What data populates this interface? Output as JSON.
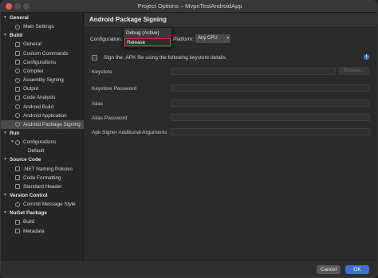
{
  "window": {
    "title": "Project Options – MvpnTestAndroidApp"
  },
  "sidebar": {
    "rows": [
      {
        "type": "group",
        "label": "General"
      },
      {
        "type": "item",
        "label": "Main Settings",
        "icon": "settings-icon"
      },
      {
        "type": "group",
        "label": "Build"
      },
      {
        "type": "item",
        "label": "General",
        "icon": "build-icon"
      },
      {
        "type": "item",
        "label": "Custom Commands",
        "icon": "terminal-icon"
      },
      {
        "type": "item",
        "label": "Configurations",
        "icon": "configurations-icon"
      },
      {
        "type": "item",
        "label": "Compiler",
        "icon": "gear-icon"
      },
      {
        "type": "item",
        "label": "Assembly Signing",
        "icon": "gear-icon"
      },
      {
        "type": "item",
        "label": "Output",
        "icon": "output-icon"
      },
      {
        "type": "item",
        "label": "Code Analysis",
        "icon": "code-analysis-icon"
      },
      {
        "type": "item",
        "label": "Android Build",
        "icon": "gear-icon"
      },
      {
        "type": "item",
        "label": "Android Application",
        "icon": "gear-icon"
      },
      {
        "type": "item",
        "label": "Android Package Signing",
        "icon": "gear-icon",
        "selected": true
      },
      {
        "type": "group",
        "label": "Run"
      },
      {
        "type": "item",
        "label": "Configurations",
        "icon": "gear-icon"
      },
      {
        "type": "subitem",
        "label": "Default"
      },
      {
        "type": "group",
        "label": "Source Code"
      },
      {
        "type": "item",
        "label": ".NET Naming Policies",
        "icon": "document-icon"
      },
      {
        "type": "item",
        "label": "Code Formatting",
        "icon": "document-icon"
      },
      {
        "type": "item",
        "label": "Standard Header",
        "icon": "document-icon"
      },
      {
        "type": "group",
        "label": "Version Control"
      },
      {
        "type": "item",
        "label": "Commit Message Style",
        "icon": "gear-icon"
      },
      {
        "type": "group",
        "label": "NuGet Package"
      },
      {
        "type": "item",
        "label": "Build",
        "icon": "document-icon"
      },
      {
        "type": "item",
        "label": "Metadata",
        "icon": "document-icon"
      }
    ]
  },
  "main": {
    "title": "Android Package Signing",
    "configuration_label": "Configuration:",
    "configuration_options": [
      "Debug (Active)",
      "Release"
    ],
    "configuration_highlighted": "Release",
    "platform_label": "Platform:",
    "platform_value": "Any CPU",
    "sign_checkbox_label": "Sign the .APK file using the following keystore details.",
    "sign_checked": false,
    "fields": [
      {
        "label": "Keystore"
      },
      {
        "label": "Keystore Password"
      },
      {
        "label": "Alias"
      },
      {
        "label": "Alias Password"
      },
      {
        "label": "Apk Signer Additional Arguments"
      }
    ],
    "browse_label": "Browse..."
  },
  "footer": {
    "cancel_label": "Cancel",
    "ok_label": "OK"
  },
  "colors": {
    "accent": "#3a72d6",
    "highlight_border": "#e03030",
    "close": "#ec5f57"
  }
}
